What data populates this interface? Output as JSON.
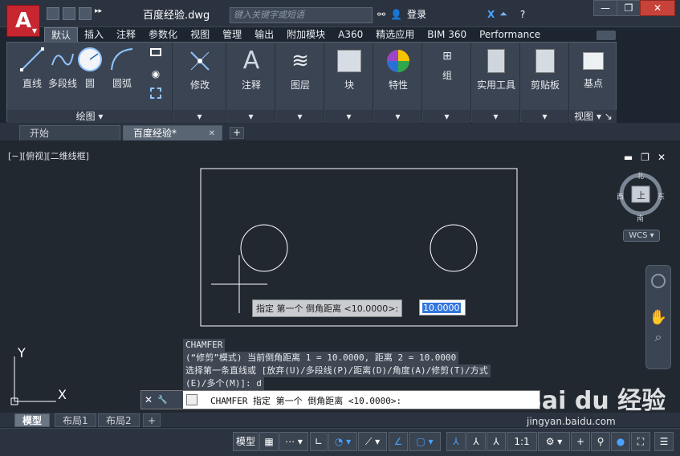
{
  "titlebar": {
    "app_letter": "A",
    "doc_title": "百度经验.dwg",
    "search_placeholder": "键入关键字或短语",
    "login_label": "登录",
    "minimize": "—",
    "restore": "❐",
    "close": "✕"
  },
  "ribbon_tabs": [
    "默认",
    "插入",
    "注释",
    "参数化",
    "视图",
    "管理",
    "输出",
    "附加模块",
    "A360",
    "精选应用",
    "BIM 360",
    "Performance"
  ],
  "ribbon": {
    "draw": {
      "line": "直线",
      "polyline": "多段线",
      "circle": "圆",
      "arc": "圆弧",
      "footer": "绘图 ▾"
    },
    "modify": {
      "label": "修改"
    },
    "annotation": {
      "label": "注释"
    },
    "layers": {
      "label": "图层"
    },
    "block": {
      "label": "块"
    },
    "properties": {
      "label": "特性"
    },
    "group": {
      "label": "组"
    },
    "utilities": {
      "label": "实用工具"
    },
    "clipboard": {
      "label": "剪贴板"
    },
    "view": {
      "label": "基点",
      "footer": "视图 ▾ ↘"
    }
  },
  "doc_tabs": {
    "start": "开始",
    "current": "百度经验*",
    "close": "✕",
    "new": "+"
  },
  "canvas": {
    "view_label": "[−][俯视][二维线框]",
    "viewcube": {
      "north": "北",
      "south": "南",
      "east": "东",
      "west": "西",
      "top": "上"
    },
    "wcs": "WCS ▾",
    "dyn_prompt": "指定 第一个 倒角距离 <10.0000>:",
    "dyn_value": "10.0000",
    "ucs_y": "Y",
    "ucs_x": "X"
  },
  "command_history": [
    "CHAMFER",
    "(“修剪”模式) 当前倒角距离 1 = 10.0000, 距离 2 = 10.0000",
    "选择第一条直线或 [放弃(U)/多段线(P)/距离(D)/角度(A)/修剪(T)/方式",
    "(E)/多个(M)]:  d"
  ],
  "command_line": {
    "close": "✕",
    "settings": "🔧",
    "text": "CHAMFER 指定 第一个 倒角距离 <10.0000>:"
  },
  "layout_tabs": {
    "model": "模型",
    "layout1": "布局1",
    "layout2": "布局2",
    "add": "+"
  },
  "statusbar": {
    "model": "模型",
    "scale": "1:1"
  },
  "watermark": {
    "brand": "Bai du 经验",
    "url": "jingyan.baidu.com"
  }
}
